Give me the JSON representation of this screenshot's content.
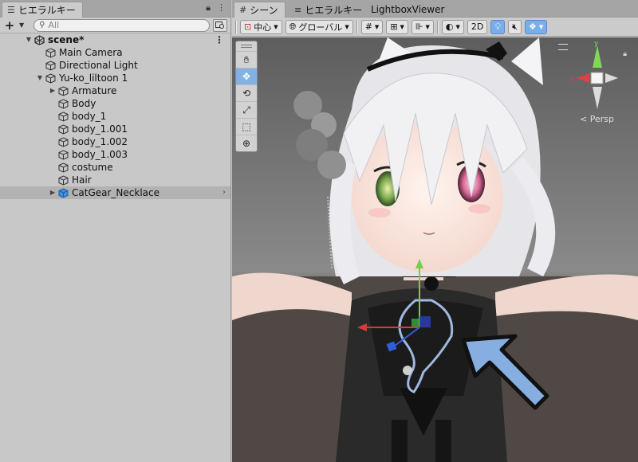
{
  "hierarchy": {
    "tab_label": "ヒエラルキー",
    "search_placeholder": "All",
    "scene_name": "scene*",
    "items": [
      {
        "label": "Main Camera",
        "depth": 2,
        "arrow": false
      },
      {
        "label": "Directional Light",
        "depth": 2,
        "arrow": false
      },
      {
        "label": "Yu-ko_liltoon 1",
        "depth": 2,
        "arrow": true,
        "expanded": true
      },
      {
        "label": "Armature",
        "depth": 3,
        "arrow": true,
        "expanded": false
      },
      {
        "label": "Body",
        "depth": 3,
        "arrow": false
      },
      {
        "label": "body_1",
        "depth": 3,
        "arrow": false
      },
      {
        "label": "body_1.001",
        "depth": 3,
        "arrow": false
      },
      {
        "label": "body_1.002",
        "depth": 3,
        "arrow": false
      },
      {
        "label": "body_1.003",
        "depth": 3,
        "arrow": false
      },
      {
        "label": "costume",
        "depth": 3,
        "arrow": false
      },
      {
        "label": "Hair",
        "depth": 3,
        "arrow": false
      },
      {
        "label": "CatGear_Necklace",
        "depth": 3,
        "arrow": true,
        "expanded": false,
        "selected": true,
        "prefab": true
      }
    ]
  },
  "scene": {
    "tabs": [
      {
        "label": "シーン",
        "icon": "#",
        "active": true
      },
      {
        "label": "ヒエラルキー",
        "icon": "≡",
        "active": false
      },
      {
        "label": "LightboxViewer",
        "icon": "",
        "active": false
      }
    ],
    "toolbar": {
      "pivot_label": "中心",
      "global_label": "グローバル",
      "mode_2d_label": "2D"
    },
    "persp_label": "Persp"
  },
  "colors": {
    "accent": "#7aaee8",
    "selection": "#b2b2b2",
    "arrow_annotation": "#86aee0"
  }
}
